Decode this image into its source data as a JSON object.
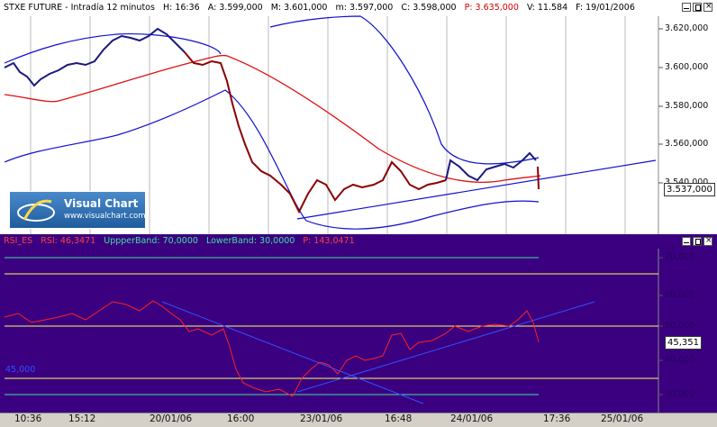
{
  "price_header": {
    "symbol": "STXE FUTURE - Intradía 12 minutos",
    "h": "H: 16:36",
    "a": "A: 3.599,000",
    "m1": "M: 3.601,000",
    "m2": "m: 3.597,000",
    "c": "C: 3.598,000",
    "p": "P: 3.635,000",
    "v": "V: 11.584",
    "f": "F: 19/01/2006"
  },
  "price_axis": [
    "3.620,000",
    "3.600,000",
    "3.580,000",
    "3.560,000",
    "3.540,000"
  ],
  "price_tag": "3.537,000",
  "logo": {
    "title": "Visual Chart",
    "url": "www.visualchart.com"
  },
  "rsi_header": {
    "name": "RSI_ES",
    "rsi": "RSI: 46,3471",
    "upper": "UppperBand: 70,0000",
    "lower": "LowerBand: 30,0000",
    "p": "P: 143,0471"
  },
  "rsi_axis": [
    "70,000",
    "60,000",
    "50,000",
    "40,000",
    "30,000"
  ],
  "rsi_tag": "45,351",
  "rsi_side_label": "45,000",
  "x_labels": [
    "10:36",
    "15:12",
    "20/01/06",
    "16:00",
    "23/01/06",
    "16:48",
    "24/01/06",
    "17:36",
    "25/01/06"
  ],
  "colors": {
    "price_bg": "#ffffff",
    "rsi_bg": "#3a0080",
    "candle": "#1a1a80",
    "ma": "#e01010",
    "band": "#1010d0"
  }
}
